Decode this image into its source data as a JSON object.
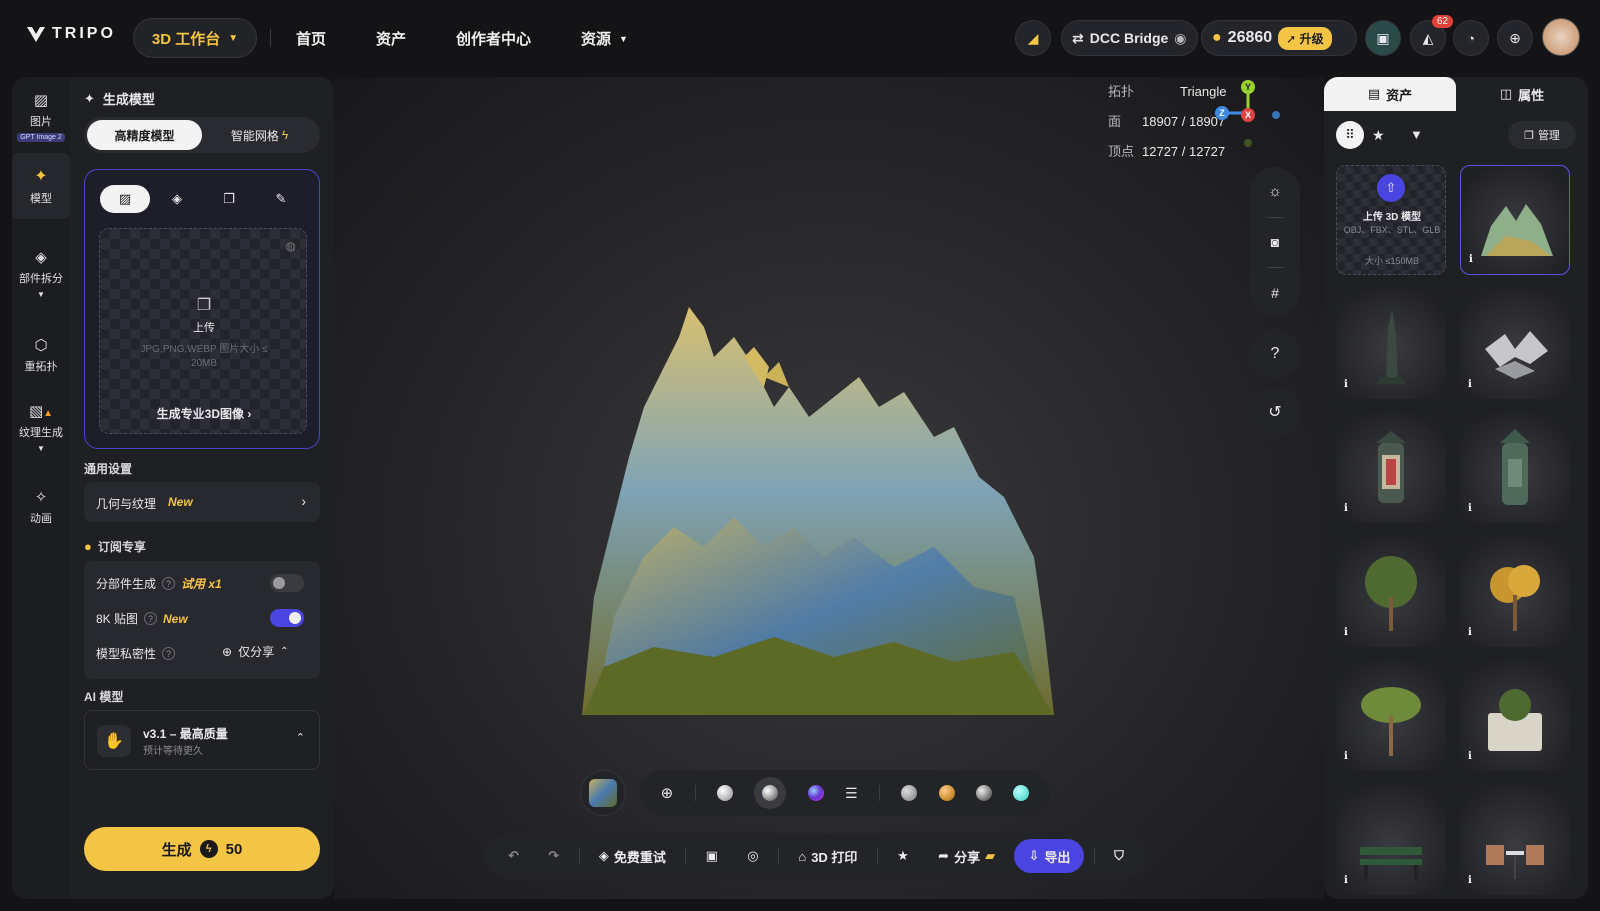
{
  "topbar": {
    "logo_text": "TRIPO",
    "workspace_label": "3D 工作台",
    "nav": [
      "首页",
      "资产",
      "创作者中心",
      "资源"
    ],
    "dcc_bridge": "DCC Bridge",
    "credits": "26860",
    "upgrade": "升级",
    "notification_count": "62"
  },
  "rail": {
    "items": [
      {
        "label": "图片",
        "tag": "GPT Image 2"
      },
      {
        "label": "模型"
      },
      {
        "label": "部件拆分"
      },
      {
        "label": "重拓扑"
      },
      {
        "label": "纹理生成"
      },
      {
        "label": "动画"
      }
    ]
  },
  "panel": {
    "title": "生成模型",
    "seg_hq": "高精度模型",
    "seg_smart": "智能网格",
    "upload_label": "上传",
    "upload_hint": "JPG,PNG,WEBP 图片大小 ≤ 20MB",
    "pro_image_link": "生成专业3D图像",
    "general_settings": "通用设置",
    "geo_texture": "几何与纹理",
    "new_tag": "New",
    "subscription": "订阅专享",
    "part_gen": "分部件生成",
    "trial": "试用 x1",
    "tex8k": "8K 贴图",
    "privacy": "模型私密性",
    "privacy_value": "仅分享",
    "ai_model_label": "AI 模型",
    "model_name": "v3.1 – 最高质量",
    "model_sub": "预计等待更久",
    "generate": "生成",
    "cost": "50"
  },
  "viewport": {
    "topology_key": "拓扑",
    "topology_val": "Triangle",
    "faces_key": "面",
    "faces_val": "18907 / 18907",
    "verts_key": "顶点",
    "verts_val": "12727 / 12727",
    "axis_y": "Y",
    "axis_z": "Z",
    "axis_x": "X",
    "help": "?"
  },
  "bottombar": {
    "free_retry": "免费重试",
    "print": "3D 打印",
    "share": "分享",
    "export": "导出"
  },
  "rpanel": {
    "tab_assets": "资产",
    "tab_props": "属性",
    "manage": "管理",
    "upload_title": "上传 3D 模型",
    "upload_formats": "OBJ、FBX、STL、GLB",
    "upload_size": "大小 ≤150MB",
    "info": "i"
  },
  "colors": {
    "accent": "#4a44e0",
    "yellow": "#f4c544",
    "badge": "#e0413b"
  }
}
